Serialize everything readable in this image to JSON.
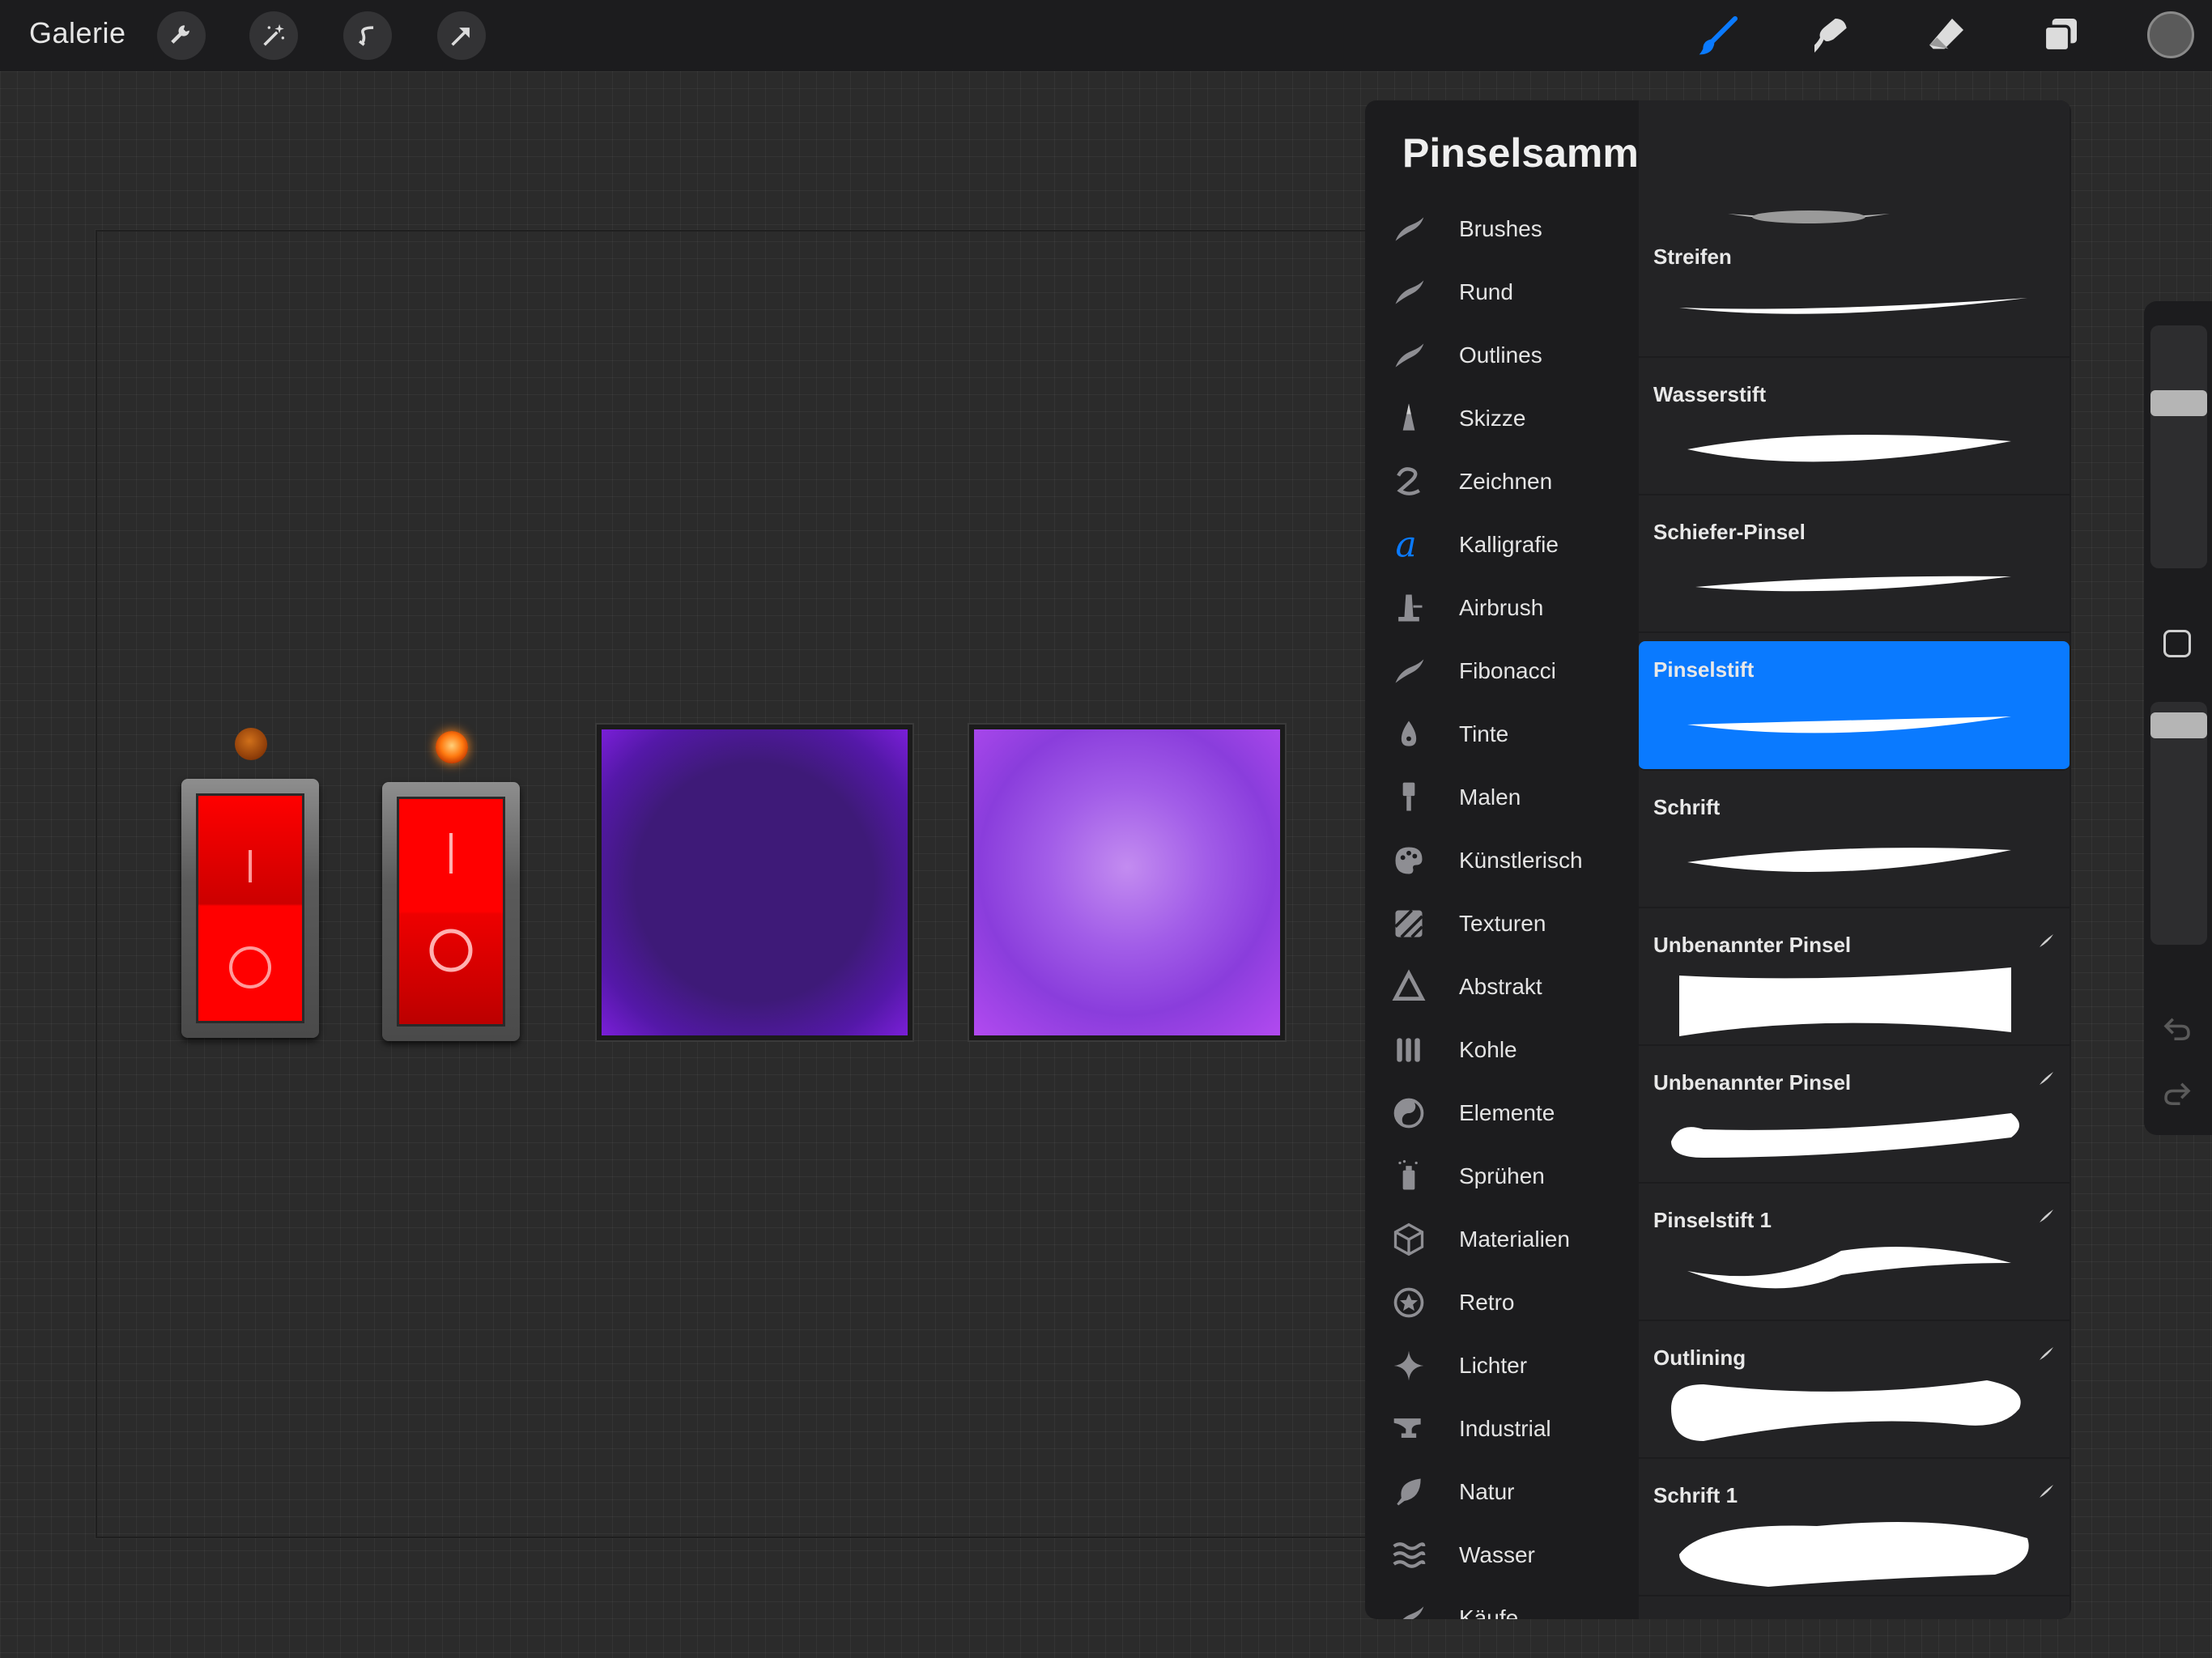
{
  "topbar": {
    "gallery_label": "Galerie",
    "left_tools": [
      "wrench-icon",
      "magic-wand-icon",
      "selection-icon",
      "transform-icon"
    ],
    "right_tools": [
      "brush-icon",
      "smudge-icon",
      "eraser-icon",
      "layers-icon"
    ],
    "active_tool": "brush-icon",
    "active_color": "#0a7aff",
    "current_color": "#5a5a5a"
  },
  "brush_library": {
    "title": "Pinselsammlung",
    "categories": [
      {
        "label": "Brushes",
        "icon": "brush-stroke-icon"
      },
      {
        "label": "Rund",
        "icon": "brush-stroke-icon"
      },
      {
        "label": "Outlines",
        "icon": "brush-stroke-icon"
      },
      {
        "label": "Skizze",
        "icon": "pencil-tip-icon"
      },
      {
        "label": "Zeichnen",
        "icon": "squiggle-icon"
      },
      {
        "label": "Kalligrafie",
        "icon": "calligraphy-a-icon"
      },
      {
        "label": "Airbrush",
        "icon": "airbrush-icon"
      },
      {
        "label": "Fibonacci",
        "icon": "brush-stroke-icon"
      },
      {
        "label": "Tinte",
        "icon": "ink-drop-icon"
      },
      {
        "label": "Malen",
        "icon": "paint-brush-icon"
      },
      {
        "label": "Künstlerisch",
        "icon": "palette-icon"
      },
      {
        "label": "Texturen",
        "icon": "texture-icon"
      },
      {
        "label": "Abstrakt",
        "icon": "triangle-icon"
      },
      {
        "label": "Kohle",
        "icon": "charcoal-icon"
      },
      {
        "label": "Elemente",
        "icon": "yin-yang-icon"
      },
      {
        "label": "Sprühen",
        "icon": "spray-can-icon"
      },
      {
        "label": "Materialien",
        "icon": "cube-icon"
      },
      {
        "label": "Retro",
        "icon": "star-circle-icon"
      },
      {
        "label": "Lichter",
        "icon": "sparkle-icon"
      },
      {
        "label": "Industrial",
        "icon": "anvil-icon"
      },
      {
        "label": "Natur",
        "icon": "leaf-icon"
      },
      {
        "label": "Wasser",
        "icon": "waves-icon"
      },
      {
        "label": "Käufe",
        "icon": "brush-stroke-icon"
      }
    ],
    "active_category": "Kalligrafie",
    "brushes": [
      {
        "name": "Streifen",
        "imported": false,
        "selected": false
      },
      {
        "name": "Wasserstift",
        "imported": false,
        "selected": false
      },
      {
        "name": "Schiefer-Pinsel",
        "imported": false,
        "selected": false
      },
      {
        "name": "Pinselstift",
        "imported": false,
        "selected": true
      },
      {
        "name": "Schrift",
        "imported": false,
        "selected": false
      },
      {
        "name": "Unbenannter Pinsel",
        "imported": true,
        "selected": false
      },
      {
        "name": "Unbenannter Pinsel",
        "imported": true,
        "selected": false
      },
      {
        "name": "Pinselstift 1",
        "imported": true,
        "selected": false
      },
      {
        "name": "Outlining",
        "imported": true,
        "selected": false
      },
      {
        "name": "Schrift 1",
        "imported": true,
        "selected": false
      }
    ]
  },
  "sidebar": {
    "size_level": 0.7,
    "opacity_level": 0.95
  }
}
